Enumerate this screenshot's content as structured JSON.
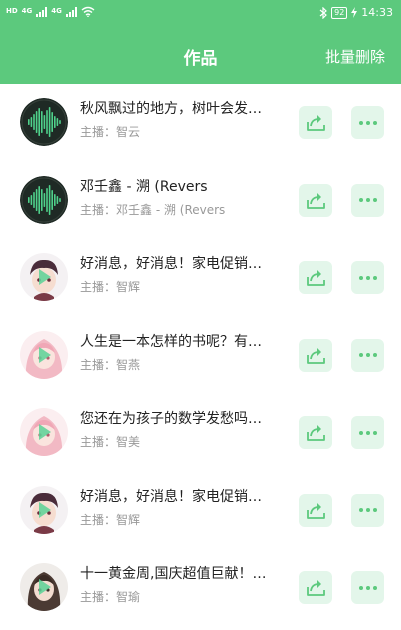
{
  "status_bar": {
    "left_labels": [
      "HD",
      "4G",
      "4G"
    ],
    "battery": "92",
    "time": "14:33",
    "icons": [
      "signal-icon",
      "wifi-icon",
      "bluetooth-icon",
      "battery-icon",
      "charging-icon"
    ]
  },
  "header": {
    "title": "作品",
    "batch_delete": "批量删除",
    "background": "#5cc97d"
  },
  "list": {
    "host_prefix": "主播：",
    "items": [
      {
        "title": "秋风飘过的地方，树叶会发…",
        "host": "主播：智云",
        "avatar": "waveform"
      },
      {
        "title": "邓壬鑫 - 溯 (Revers",
        "host": "主播：邓壬鑫 - 溯 (Revers",
        "avatar": "waveform"
      },
      {
        "title": "好消息，好消息！家电促销…",
        "host": "主播：智辉",
        "avatar": "boy"
      },
      {
        "title": "人生是一本怎样的书呢？有…",
        "host": "主播：智燕",
        "avatar": "girl-pink"
      },
      {
        "title": "您还在为孩子的数学发愁吗…",
        "host": "主播：智美",
        "avatar": "girl-pink"
      },
      {
        "title": "好消息，好消息！家电促销…",
        "host": "主播：智辉",
        "avatar": "boy"
      },
      {
        "title": "十一黄金周,国庆超值巨献！…",
        "host": "主播：智瑜",
        "avatar": "girl-dark"
      }
    ]
  },
  "colors": {
    "accent": "#5cc97d",
    "button_bg": "#e3f6ea",
    "title_text": "#222222",
    "sub_text": "#999999"
  }
}
